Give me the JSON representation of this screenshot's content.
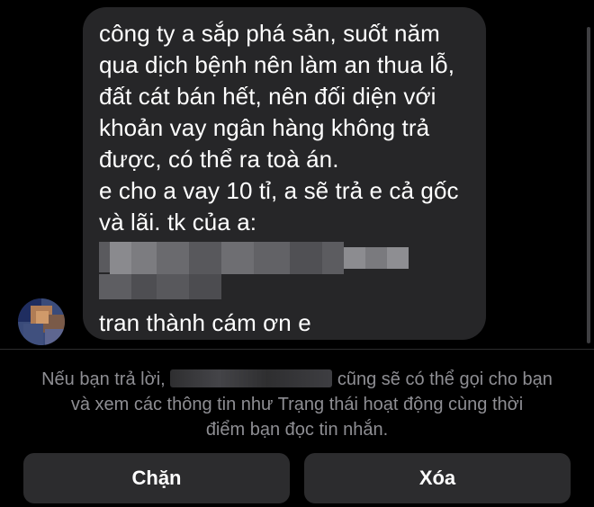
{
  "conversation": {
    "message_lines": [
      "công ty a sắp phá sản, suốt năm",
      "qua dịch bệnh nên làm an thua lỗ,",
      "đất cát bán hết, nên đối diện với",
      "khoản vay ngân hàng không trả",
      "được, có thể ra toà án.",
      "e cho a vay 10 tỉ, a sẽ trả e cả gốc",
      "và lãi. tk của a:"
    ],
    "signature": "tran thành cám ơn e"
  },
  "request_notice": {
    "prefix": "Nếu bạn trả lời,",
    "suffix": "cũng sẽ có thể gọi cho bạn",
    "line2": "và xem các thông tin như Trạng thái hoạt động cùng thời",
    "line3": "điểm bạn đọc tin nhắn."
  },
  "actions": {
    "block_label": "Chặn",
    "delete_label": "Xóa"
  },
  "colors": {
    "background": "#000000",
    "bubble": "#262628",
    "button": "#2c2c2e",
    "notice_text": "#8e8e93"
  }
}
